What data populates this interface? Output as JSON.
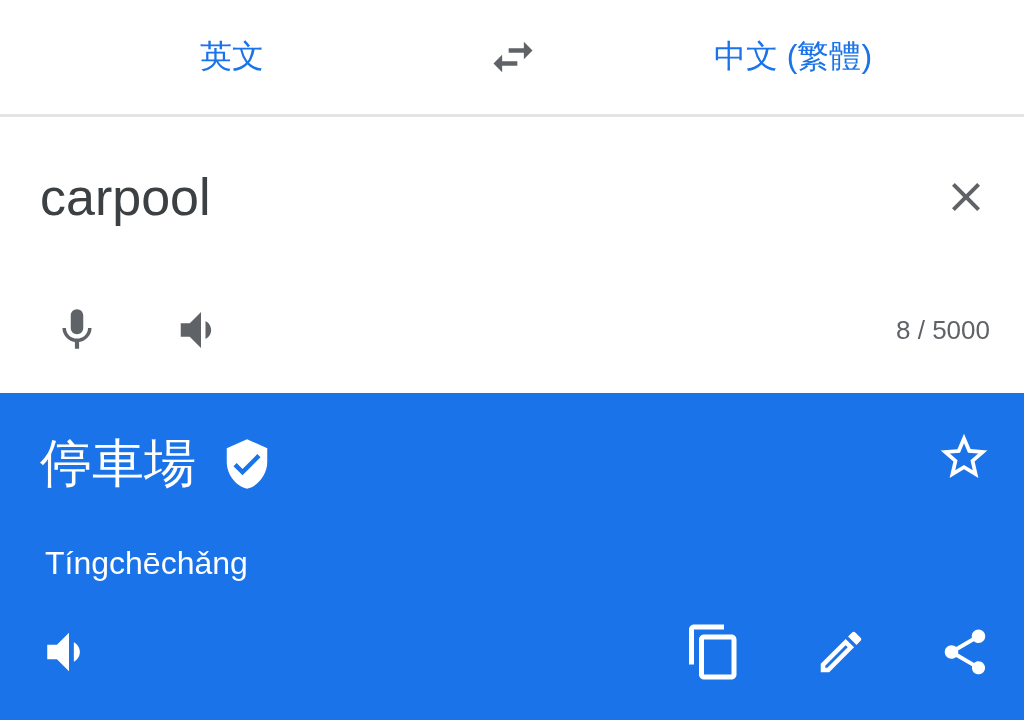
{
  "languages": {
    "source": "英文",
    "target": "中文 (繁體)"
  },
  "input": {
    "value": "carpool",
    "char_count": "8 / 5000"
  },
  "result": {
    "translation": "停車場",
    "verified": true,
    "starred": false,
    "romanization": "Tíngchēchǎng"
  }
}
